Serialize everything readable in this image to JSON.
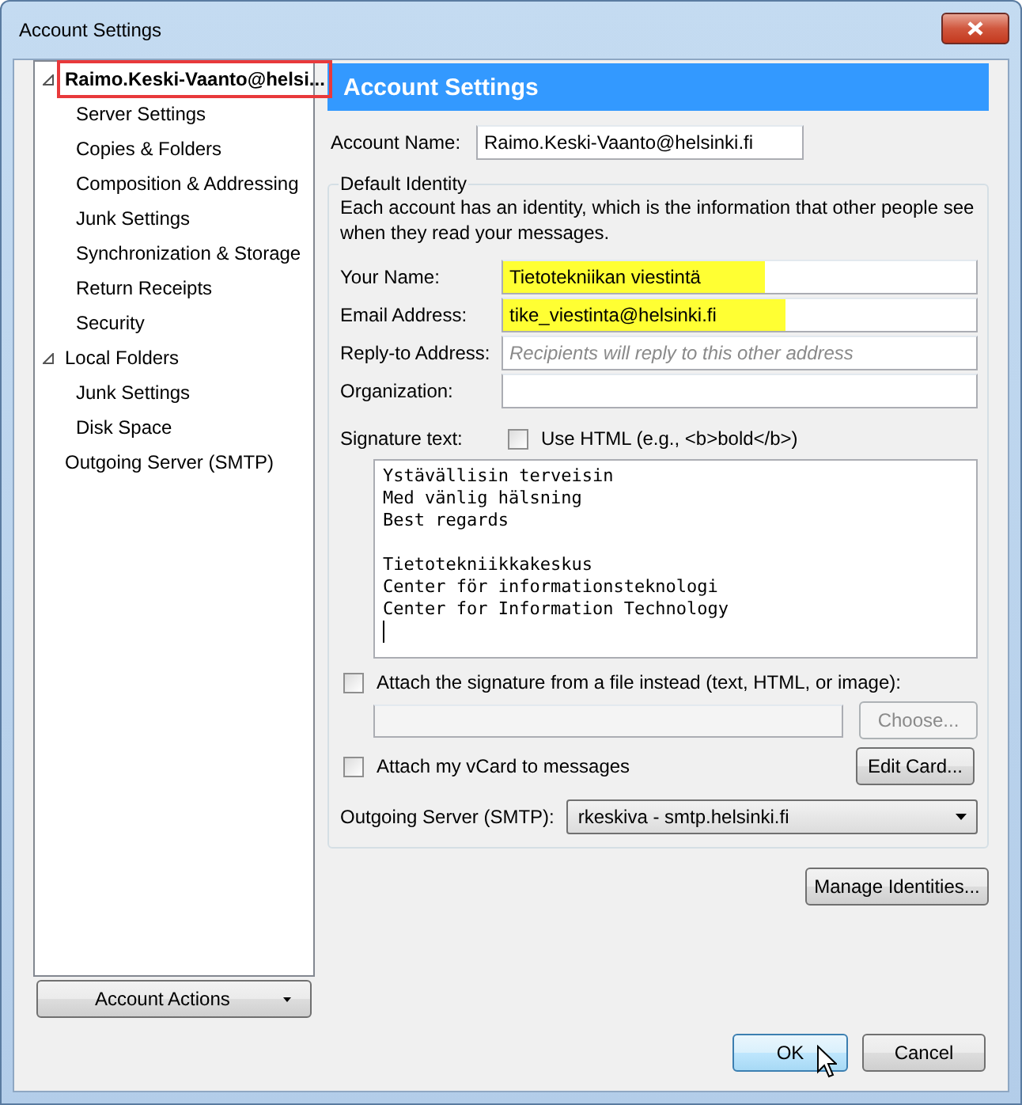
{
  "window": {
    "title": "Account Settings"
  },
  "tree": [
    {
      "label": "Raimo.Keski-Vaanto@helsi...",
      "bold": true,
      "expanded": true,
      "highlighted": true,
      "children": [
        {
          "label": "Server Settings"
        },
        {
          "label": "Copies & Folders"
        },
        {
          "label": "Composition & Addressing"
        },
        {
          "label": "Junk Settings"
        },
        {
          "label": "Synchronization & Storage"
        },
        {
          "label": "Return Receipts"
        },
        {
          "label": "Security"
        }
      ]
    },
    {
      "label": "Local Folders",
      "bold": false,
      "expanded": true,
      "highlighted": false,
      "children": [
        {
          "label": "Junk Settings"
        },
        {
          "label": "Disk Space"
        }
      ]
    },
    {
      "label": "Outgoing Server (SMTP)",
      "bold": false,
      "highlighted": false
    }
  ],
  "account_actions": {
    "label": "Account Actions"
  },
  "panel": {
    "title": "Account Settings",
    "account_name": {
      "label": "Account Name:",
      "value": "Raimo.Keski-Vaanto@helsinki.fi"
    },
    "default_identity": {
      "legend": "Default Identity",
      "description": "Each account has an identity, which is the information that other people see when they read your messages.",
      "fields": [
        {
          "label": "Your Name:",
          "value": "Tietotekniikan viestintä",
          "highlighted": true
        },
        {
          "label": "Email Address:",
          "value": "tike_viestinta@helsinki.fi",
          "highlighted": true
        },
        {
          "label": "Reply-to Address:",
          "placeholder": "Recipients will reply to this other address",
          "highlighted": false
        },
        {
          "label": "Organization:",
          "highlighted": false
        }
      ],
      "signature": {
        "label": "Signature text:",
        "use_html": {
          "label": "Use HTML (e.g., <b>bold</b>)",
          "checked": false
        },
        "text": "Ystävällisin terveisin\nMed vänlig hälsning\nBest regards\n\nTietotekniikkakeskus\nCenter för informationsteknologi\nCenter for Information Technology"
      },
      "attach_file": {
        "label": "Attach the signature from a file instead (text, HTML, or image):",
        "checked": false
      },
      "choose_button": {
        "label": "Choose...",
        "disabled": true
      },
      "vcard": {
        "label": "Attach my vCard to messages",
        "checked": false
      },
      "edit_card_button": {
        "label": "Edit Card...",
        "disabled": false
      },
      "smtp": {
        "label": "Outgoing Server (SMTP):",
        "value": "rkeskiva - smtp.helsinki.fi"
      }
    },
    "manage_identities": {
      "label": "Manage Identities..."
    }
  },
  "buttons": [
    {
      "label": "OK",
      "default": true
    },
    {
      "label": "Cancel",
      "default": false
    }
  ]
}
